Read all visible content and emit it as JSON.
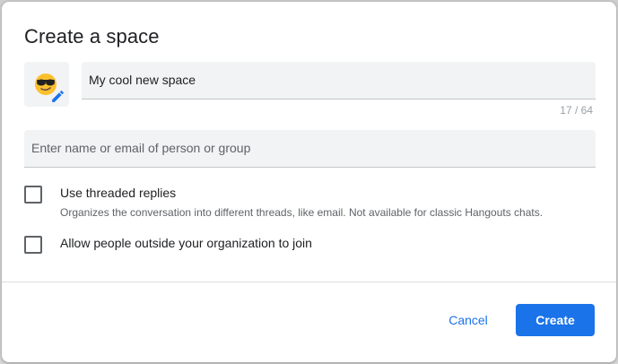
{
  "dialog": {
    "title": "Create a space",
    "emoji_icon": "sunglasses-emoji-icon",
    "edit_icon": "pencil-icon",
    "name_field": {
      "value": "My cool new space",
      "counter": "17 / 64"
    },
    "people_field": {
      "placeholder": "Enter name or email of person or group"
    },
    "options": [
      {
        "label": "Use threaded replies",
        "description": "Organizes the conversation into different threads, like email. Not available for classic Hangouts chats.",
        "checked": false
      },
      {
        "label": "Allow people outside your organization to join",
        "checked": false
      }
    ],
    "cancel_label": "Cancel",
    "create_label": "Create"
  },
  "colors": {
    "accent": "#1a73e8",
    "field_bg": "#f1f3f4",
    "text_primary": "#202124",
    "text_secondary": "#5f6368"
  }
}
